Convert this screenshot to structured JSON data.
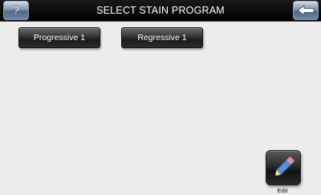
{
  "header": {
    "title": "SELECT STAIN PROGRAM",
    "help_icon": "help-icon",
    "back_icon": "back-arrow-icon"
  },
  "programs": [
    {
      "label": "Progressive 1"
    },
    {
      "label": "Regressive 1"
    }
  ],
  "edit": {
    "label": "Edit",
    "icon": "pencil-icon"
  },
  "colors": {
    "topbar": "#000000",
    "background": "#ececec",
    "program_button": "#2a2a2a",
    "corner_button": "#7f96b3"
  }
}
